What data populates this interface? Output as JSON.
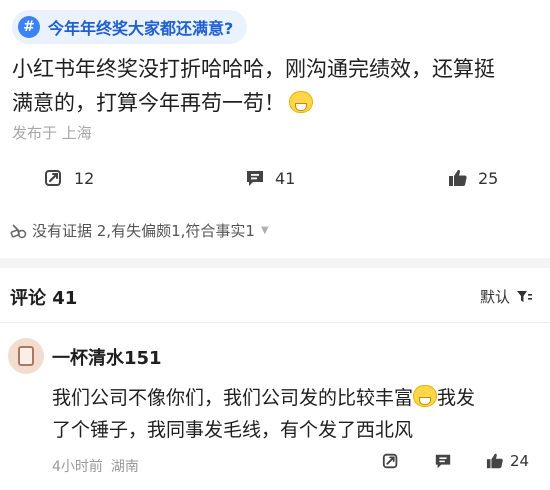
{
  "post": {
    "topic_tag": "今年年终奖大家都还满意?",
    "text_line1": "小红书年终奖没打折哈哈哈，刚沟通完绩效，还算挺",
    "text_line2": "满意的，打算今年再苟一苟！",
    "location": "发布于 上海",
    "stats": {
      "reposts": "12",
      "comments": "41",
      "likes": "25"
    },
    "fact_check": "没有证据 2,有失偏颇1,符合事实1"
  },
  "comments_section": {
    "title": "评论 41",
    "sort_label": "默认"
  },
  "comment": {
    "user_name": "一杯清水151",
    "text_line1": "我们公司不像你们，我们公司发的比较丰富",
    "text_line1_tail": "我发",
    "text_line2": "了个锤子，我同事发毛线，有个发了西北风",
    "time": "4小时前",
    "location": "湖南",
    "likes": "24"
  },
  "icons": {
    "topic": "hash-icon",
    "repost": "repost-icon",
    "comment": "comment-icon",
    "like": "thumbs-up-icon",
    "fact": "fact-check-icon",
    "sort": "filter-icon",
    "emoji": "grin-emoji-icon"
  },
  "colors": {
    "accent": "#3b82f6",
    "tag_bg": "#eaf2ff",
    "meta_text": "#a8a8a8"
  }
}
